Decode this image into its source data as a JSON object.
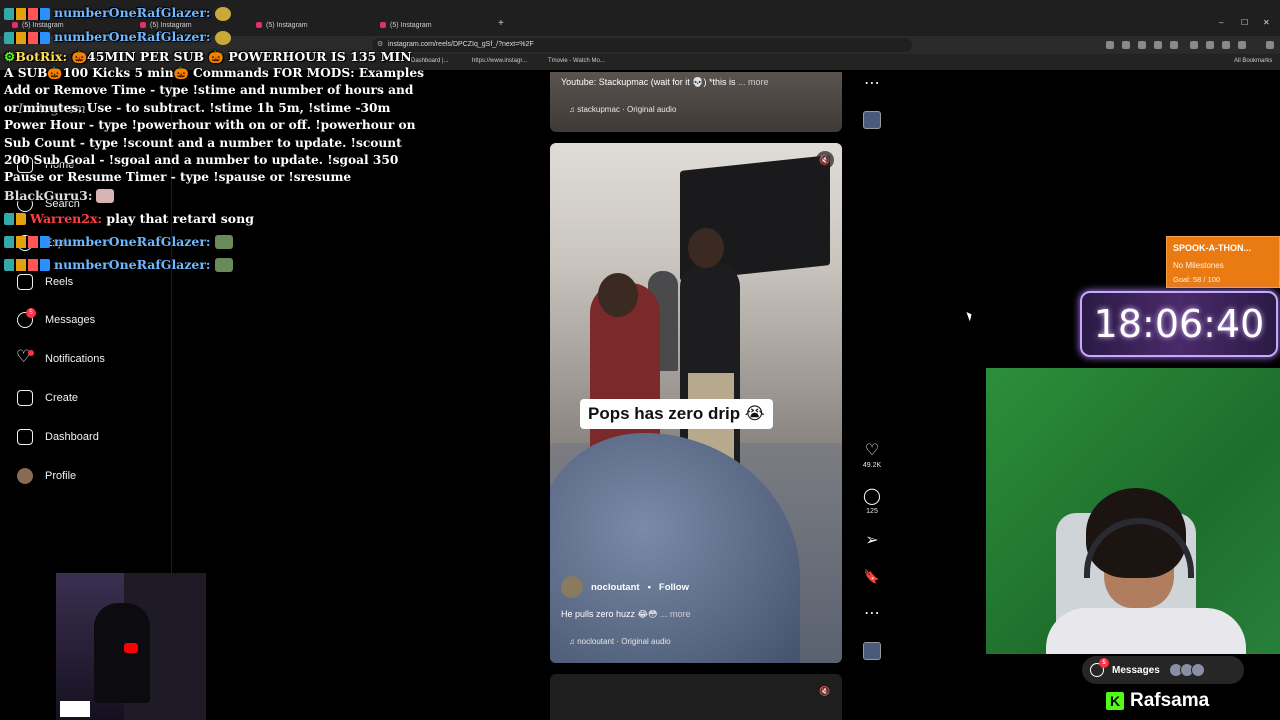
{
  "browser": {
    "tabs": [
      {
        "label": "(5) Instagram"
      },
      {
        "label": "(5) Instagram"
      },
      {
        "label": "(5) Instagram"
      },
      {
        "label": "(5) Instagram"
      }
    ],
    "new_tab": "+",
    "url": "instagram.com/reels/DPCZIq_gSf_/?next=%2F",
    "bookmarks": [
      {
        "label": "Dashboard |..."
      },
      {
        "label": "https://www.instagr..."
      },
      {
        "label": "Tmovie - Watch Mo..."
      },
      {
        "label": "All Bookmarks"
      }
    ],
    "window_controls": {
      "minimize": "–",
      "maximize": "☐",
      "close": "✕"
    }
  },
  "sidebar": {
    "logo": "Instagram",
    "items": [
      {
        "label": "Home"
      },
      {
        "label": "Search"
      },
      {
        "label": "Explore"
      },
      {
        "label": "Reels"
      },
      {
        "label": "Messages",
        "badge": "5"
      },
      {
        "label": "Notifications"
      },
      {
        "label": "Create"
      },
      {
        "label": "Dashboard"
      },
      {
        "label": "Profile"
      }
    ]
  },
  "chat": {
    "lines": [
      {
        "user": "numberOneRafGlazer:",
        "text": ""
      },
      {
        "user": "numberOneRafGlazer:",
        "text": ""
      },
      {
        "user": "BotRix:",
        "text": "🎃45MIN PER SUB 🎃 POWERHOUR IS 135 MIN"
      }
    ],
    "commands": "A SUB🎃100 Kicks 5 min🎃 Commands FOR MODS: Examples Add or Remove Time - type !stime and number of hours and or minutes. Use - to subtract. !stime 1h 5m, !stime -30m Power Hour - type !powerhour with on or off. !powerhour on Sub Count - type !scount and a number to update. !scount 200 Sub Goal - !sgoal and a number to update. !sgoal 350 Pause or Resume Timer - type !spause or !sresume",
    "lines_after": [
      {
        "user": "BlackGuru3:",
        "text": ""
      },
      {
        "user": "Warren2x:",
        "text": "play that retard song"
      },
      {
        "user": "numberOneRafGlazer:",
        "text": ""
      },
      {
        "user": "numberOneRafGlazer:",
        "text": ""
      }
    ]
  },
  "reels": {
    "previous": {
      "caption": "Youtube: Stackupmac (wait for it 💀) *this is",
      "more": "... more",
      "audio": "stackupmac · Original audio"
    },
    "current": {
      "overlay_text": "Pops has zero drip 😭",
      "username": "nocloutant",
      "separator": "•",
      "follow": "Follow",
      "caption": "He pulls zero huzz 😂😳",
      "more": "... more",
      "audio": "nocloutant · Original audio",
      "likes": "49.2K",
      "comments": "125"
    }
  },
  "icons": {
    "more": "⋯",
    "heart": "♡",
    "comment": "◯",
    "share": "➢",
    "bookmark": "🔖",
    "mute": "🔇",
    "music": "♫"
  },
  "overlays": {
    "subathon_title": "SPOOK-A-THON...",
    "milestones": "No Milestones",
    "goal": "Goal: 58 / 100",
    "timer": "18:06:40",
    "messages_label": "Messages",
    "messages_badge": "5",
    "brand": "Rafsama",
    "brand_icon": "K"
  },
  "colors": {
    "instagram_red": "#ff3040",
    "subathon_orange": "#e97b12",
    "kick_green": "#53fc18"
  }
}
